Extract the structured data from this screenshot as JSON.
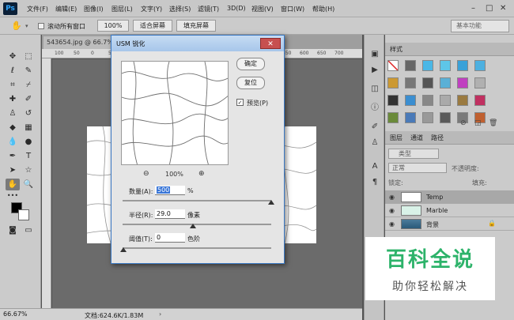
{
  "app": {
    "logo": "Ps",
    "menu": [
      "文件(F)",
      "编辑(E)",
      "图像(I)",
      "图层(L)",
      "文字(Y)",
      "选择(S)",
      "滤镜(T)",
      "3D(D)",
      "视图(V)",
      "窗口(W)",
      "帮助(H)"
    ],
    "window_controls": [
      "–",
      "□",
      "✕"
    ]
  },
  "options_bar": {
    "scroll_all_label": "滚动所有窗口",
    "btn_100": "100%",
    "btn_fit": "适合屏幕",
    "btn_fill": "填充屏幕",
    "workspace": "基本功能"
  },
  "document": {
    "tab_title": "543654.jpg @ 66.7%",
    "ruler_ticks": [
      "100",
      "50",
      "0",
      "50",
      "100",
      "150",
      "200",
      "250",
      "300",
      "350",
      "400",
      "450",
      "500",
      "550",
      "600",
      "650",
      "700"
    ],
    "zoom": "66.67%",
    "doc_info": "文档:624.6K/1.83M"
  },
  "dialog": {
    "title": "USM 锐化",
    "close": "✕",
    "ok_label": "确定",
    "reset_label": "复位",
    "preview_label": "预览(P)",
    "preview_checked": "✓",
    "zoom_out": "⊖",
    "zoom_in": "⊕",
    "zoom_level": "100%",
    "amount_label": "数量(A):",
    "amount_value": "500",
    "amount_unit": "%",
    "radius_label": "半径(R):",
    "radius_value": "29.0",
    "radius_unit": "像素",
    "threshold_label": "阈值(T):",
    "threshold_value": "0",
    "threshold_unit": "色阶"
  },
  "panels": {
    "swatches_tab": "样式",
    "layers_tabs": [
      "图层",
      "通道",
      "路径"
    ],
    "kind_filter": "类型",
    "blend_mode": "正常",
    "opacity_label": "不透明度:",
    "lock_label": "锁定:",
    "fill_label": "填充:",
    "layers": [
      {
        "name": "Temp",
        "selected": true
      },
      {
        "name": "Marble",
        "selected": false
      },
      {
        "name": "背景",
        "selected": false
      }
    ]
  },
  "watermark": {
    "big": "百科全说",
    "small": "助你轻松解决"
  }
}
